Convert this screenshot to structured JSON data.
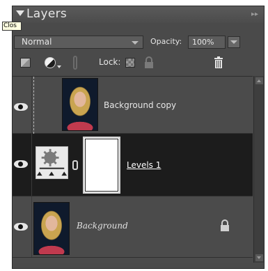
{
  "panel": {
    "title": "Layers",
    "tooltip": "Clos",
    "menu_glyph": "▸▸"
  },
  "blend": {
    "mode": "Normal",
    "opacity_label": "Opacity:",
    "opacity_value": "100%"
  },
  "toolbar": {
    "lock_label": "Lock:"
  },
  "layers": [
    {
      "name": "Background copy",
      "visible": true,
      "style": "normal"
    },
    {
      "name": "Levels 1",
      "visible": true,
      "style": "underlined",
      "selected": true
    },
    {
      "name": "Background",
      "visible": true,
      "style": "italic",
      "locked": true
    }
  ],
  "colors": {
    "panel_bg": "#4a4a4a",
    "selected_row": "#1c1c1c"
  }
}
